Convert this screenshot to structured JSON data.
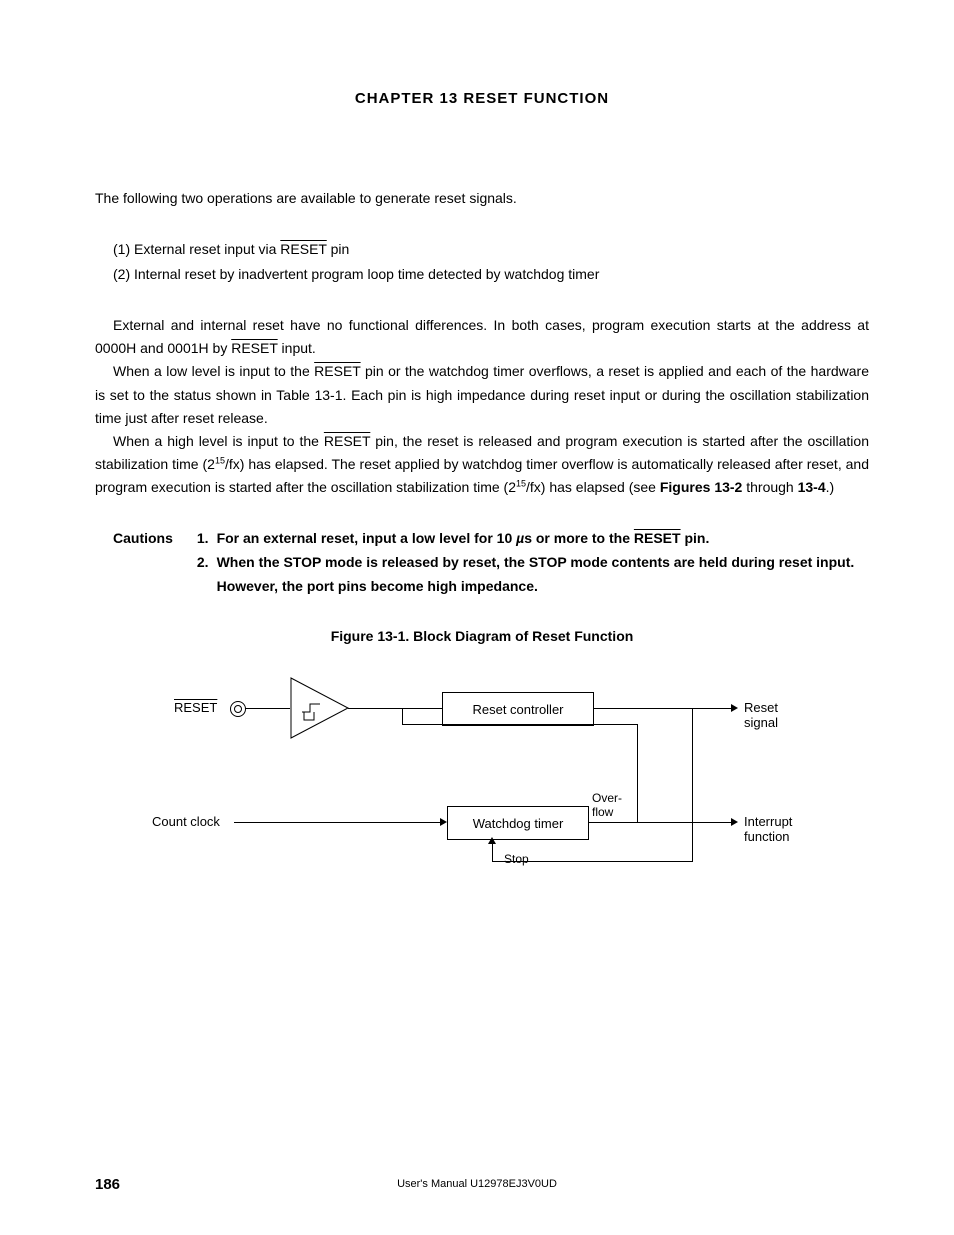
{
  "chapter_title": "CHAPTER  13    RESET  FUNCTION",
  "intro": "The following two operations are available to generate reset signals.",
  "list": {
    "item1_pre": "(1)  External reset input via ",
    "item1_reset": "RESET",
    "item1_post": " pin",
    "item2": "(2)  Internal reset by inadvertent program loop time detected by watchdog timer"
  },
  "p1_a": "External and internal reset have no functional differences.  In both cases, program execution starts at the address at 0000H and 0001H by ",
  "p1_reset": "RESET",
  "p1_b": " input.",
  "p2_a": "When a low level is input to the ",
  "p2_reset": "RESET",
  "p2_b": " pin or the watchdog timer overflows, a reset is applied and each of the hardware is set to the status shown in Table 13-1.  Each pin is high impedance during reset input or during the oscillation stabilization time just after reset release.",
  "p3_a": "When a high level is input to the ",
  "p3_reset": "RESET",
  "p3_b": " pin, the reset is released and program execution is started after the oscillation stabilization time (2",
  "p3_exp1": "15",
  "p3_c": "/fx) has elapsed.  The reset applied by watchdog timer overflow is automatically released after reset, and program execution is started after the oscillation stabilization time (2",
  "p3_exp2": "15",
  "p3_d": "/fx) has elapsed (see ",
  "p3_figs1": "Figures 13-2",
  "p3_e": " through ",
  "p3_figs2": "13-4",
  "p3_f": ".)",
  "cautions_label": "Cautions",
  "caution1_num": "1.",
  "caution1_a": "For an external reset, input a low level for 10 ",
  "caution1_mu": "µ",
  "caution1_b": "s or more to the ",
  "caution1_reset": "RESET",
  "caution1_c": " pin.",
  "caution2_num": "2.",
  "caution2": "When the STOP mode is released by reset, the STOP mode contents are held during reset input.  However, the port pins become high impedance.",
  "figure_title": "Figure 13-1.  Block Diagram of Reset Function",
  "diagram": {
    "reset_pin": "RESET",
    "reset_controller": "Reset controller",
    "watchdog_timer": "Watchdog timer",
    "count_clock": "Count clock",
    "stop": "Stop",
    "overflow": "Over-\nflow",
    "reset_signal": "Reset signal",
    "interrupt_function": "Interrupt function"
  },
  "footer": "User's Manual  U12978EJ3V0UD",
  "page_number": "186"
}
